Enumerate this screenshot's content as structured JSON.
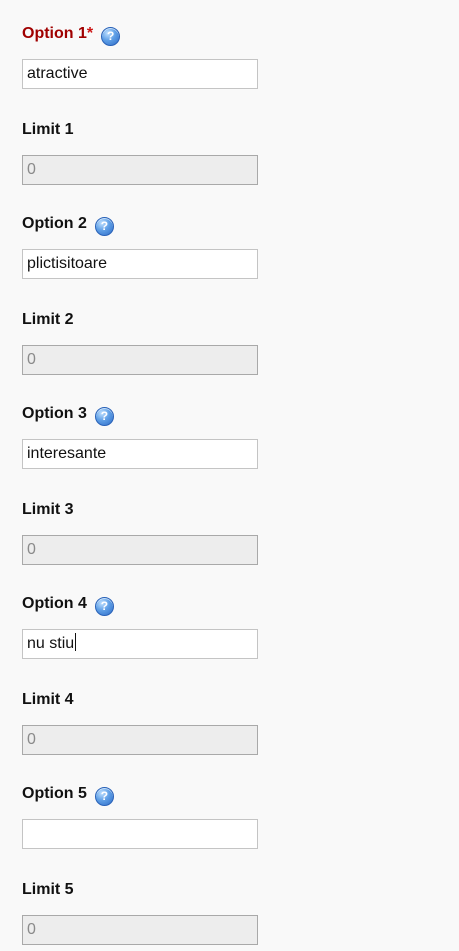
{
  "form": {
    "fields": [
      {
        "label": "Option 1",
        "required_mark": "*",
        "help_icon": "question-circle-icon",
        "value": "atractive",
        "label_color": "#a00000"
      },
      {
        "label": "Limit 1",
        "value": "0",
        "disabled": true
      },
      {
        "label": "Option 2",
        "help_icon": "question-circle-icon",
        "value": "plictisitoare"
      },
      {
        "label": "Limit 2",
        "value": "0",
        "disabled": true
      },
      {
        "label": "Option 3",
        "help_icon": "question-circle-icon",
        "value": "interesante"
      },
      {
        "label": "Limit 3",
        "value": "0",
        "disabled": true
      },
      {
        "label": "Option 4",
        "help_icon": "question-circle-icon",
        "value": "nu stiu",
        "focused": true
      },
      {
        "label": "Limit 4",
        "value": "0",
        "disabled": true
      },
      {
        "label": "Option 5",
        "help_icon": "question-circle-icon",
        "value": ""
      },
      {
        "label": "Limit 5",
        "value": "0",
        "disabled": true
      }
    ]
  }
}
